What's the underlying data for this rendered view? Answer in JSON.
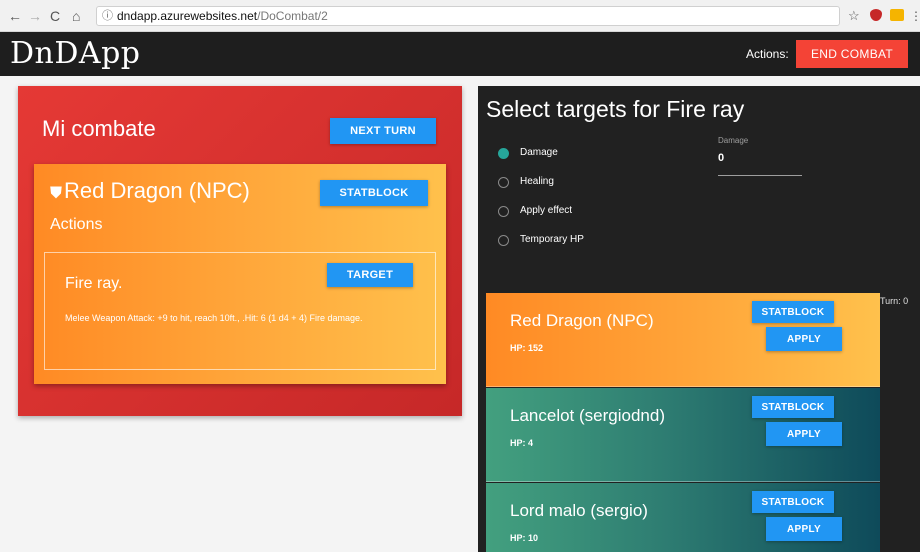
{
  "browser": {
    "back": "←",
    "forward": "→",
    "reload": "C",
    "home": "⌂",
    "info_icon": "ⓘ",
    "url_host": "dndapp.azurewebsites.net",
    "url_path": "/DoCombat/2",
    "star": "☆"
  },
  "header": {
    "logo": "DnDApp",
    "actions_label": "Actions:",
    "end_combat": "END COMBAT",
    "end_combat_color": "#f44336"
  },
  "combat": {
    "title": "Mi combate",
    "next_turn": "NEXT TURN",
    "npc": {
      "name": "Red Dragon (NPC)",
      "icon": "shield-icon",
      "statblock": "STATBLOCK",
      "actions_heading": "Actions",
      "action": {
        "name": "Fire ray.",
        "target": "TARGET",
        "description": "Melee Weapon Attack: +9 to hit, reach 10ft., .Hit: 6 (1 d4 + 4) Fire damage."
      }
    }
  },
  "targets_panel": {
    "title": "Select targets for Fire ray",
    "options": [
      {
        "label": "Damage",
        "checked": true
      },
      {
        "label": "Healing",
        "checked": false
      },
      {
        "label": "Apply effect",
        "checked": false
      },
      {
        "label": "Temporary HP",
        "checked": false
      }
    ],
    "damage_field": {
      "label": "Damage",
      "value": "0"
    },
    "turn_label": "Turn: 0",
    "targets": [
      {
        "name": "Red Dragon (NPC)",
        "hp": "HP: 152",
        "statblock": "STATBLOCK",
        "apply": "APPLY",
        "style": "orange"
      },
      {
        "name": "Lancelot (sergiodnd)",
        "hp": "HP: 4",
        "statblock": "STATBLOCK",
        "apply": "APPLY",
        "style": "teal"
      },
      {
        "name": "Lord malo (sergio)",
        "hp": "HP: 10",
        "statblock": "STATBLOCK",
        "apply": "APPLY",
        "style": "teal"
      }
    ]
  },
  "colors": {
    "accent_blue": "#2196f3",
    "combat_red": "#e53935",
    "npc_orange": "#ffa63a",
    "radio_teal": "#26a69a"
  }
}
